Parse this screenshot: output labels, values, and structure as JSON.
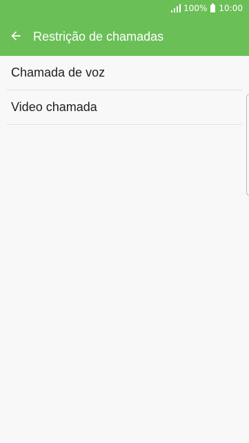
{
  "status_bar": {
    "battery_percent": "100%",
    "time": "10:00",
    "signal_icon": "signal-icon",
    "battery_icon": "battery-icon"
  },
  "app_bar": {
    "title": "Restrição de chamadas",
    "back_icon": "arrow-left-icon"
  },
  "list": {
    "items": [
      {
        "label": "Chamada de voz"
      },
      {
        "label": "Video chamada"
      }
    ]
  },
  "colors": {
    "accent": "#6bbf57",
    "background": "#f8f8f8",
    "text": "#1f1f1f",
    "divider": "#e2e2e2"
  }
}
